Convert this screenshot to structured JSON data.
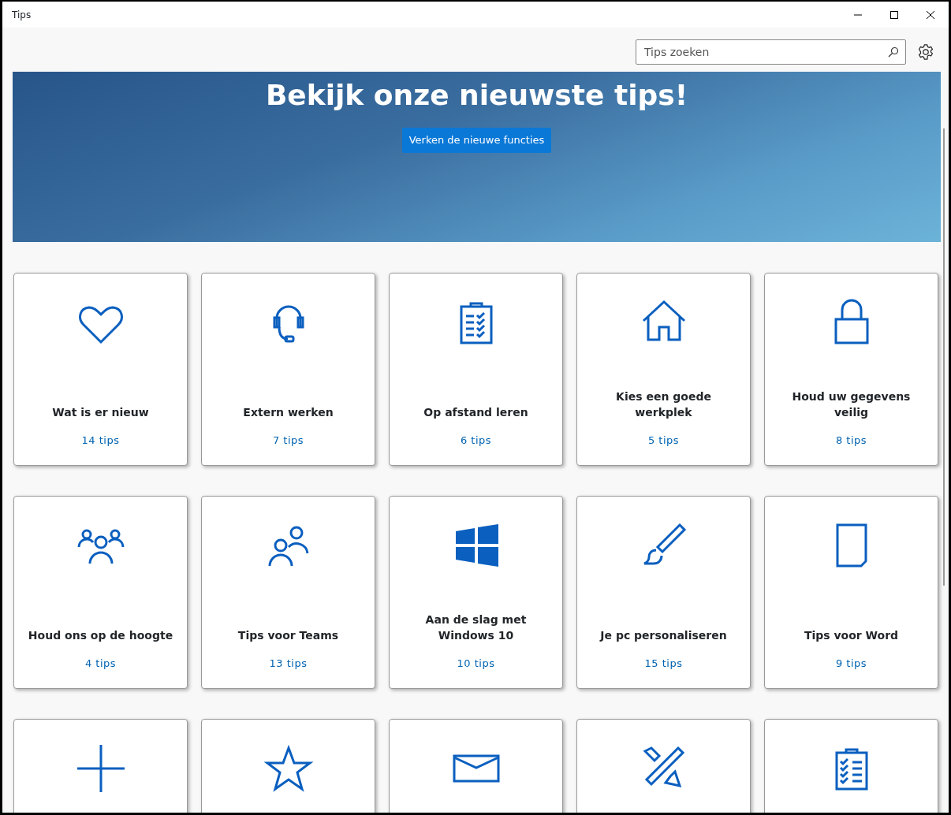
{
  "window": {
    "title": "Tips"
  },
  "search": {
    "placeholder": "Tips zoeken"
  },
  "banner": {
    "title": "Bekijk onze nieuwste tips!",
    "button": "Verken de nieuwe functies"
  },
  "cards": [
    {
      "kind": "full",
      "title": "Wat is er nieuw",
      "count": "14 tips"
    },
    {
      "kind": "full",
      "title": "Extern werken",
      "count": "7 tips"
    },
    {
      "kind": "full",
      "title": "Op afstand leren",
      "count": "6 tips"
    },
    {
      "kind": "full",
      "title": "Kies een goede werkplek",
      "count": "5 tips"
    },
    {
      "kind": "full",
      "title": "Houd uw gegevens veilig",
      "count": "8 tips"
    },
    {
      "kind": "full",
      "title": "Houd ons op de hoogte",
      "count": "4 tips"
    },
    {
      "kind": "full",
      "title": "Tips voor Teams",
      "count": "13 tips"
    },
    {
      "kind": "full",
      "title": "Aan de slag met Windows 10",
      "count": "10 tips"
    },
    {
      "kind": "full",
      "title": "Je pc personaliseren",
      "count": "15 tips"
    },
    {
      "kind": "full",
      "title": "Tips voor Word",
      "count": "9 tips"
    },
    {
      "kind": "cut_off"
    },
    {
      "kind": "cut_off"
    },
    {
      "kind": "cut_off"
    },
    {
      "kind": "cut_off"
    },
    {
      "kind": "cut_off"
    }
  ]
}
